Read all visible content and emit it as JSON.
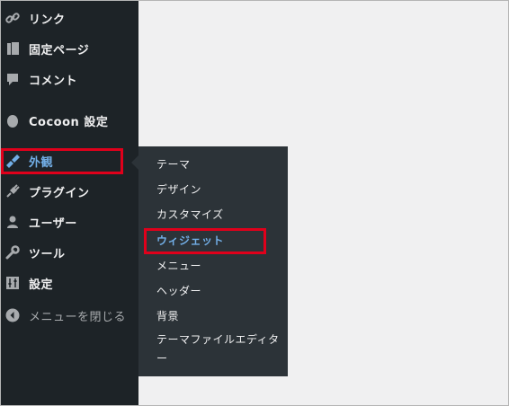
{
  "sidebar": {
    "items": [
      {
        "label": "リンク",
        "icon": "link-icon"
      },
      {
        "label": "固定ページ",
        "icon": "page-icon"
      },
      {
        "label": "コメント",
        "icon": "comment-icon"
      },
      {
        "label": "Cocoon 設定",
        "icon": "circle-icon"
      },
      {
        "label": "外観",
        "icon": "appearance-brush-icon",
        "active": true
      },
      {
        "label": "プラグイン",
        "icon": "plugin-icon"
      },
      {
        "label": "ユーザー",
        "icon": "user-icon"
      },
      {
        "label": "ツール",
        "icon": "wrench-icon"
      },
      {
        "label": "設定",
        "icon": "settings-sliders-icon"
      },
      {
        "label": "メニューを閉じる",
        "icon": "collapse-arrow-icon"
      }
    ]
  },
  "submenu": {
    "items": [
      {
        "label": "テーマ"
      },
      {
        "label": "デザイン"
      },
      {
        "label": "カスタマイズ"
      },
      {
        "label": "ウィジェット",
        "current": true
      },
      {
        "label": "メニュー"
      },
      {
        "label": "ヘッダー"
      },
      {
        "label": "背景"
      },
      {
        "label": "テーマファイルエディター"
      }
    ]
  },
  "colors": {
    "sidebar_bg": "#1d2327",
    "submenu_bg": "#2c3338",
    "accent": "#72aee6",
    "highlight_border": "#e0001b",
    "content_bg": "#f0f0f1"
  }
}
